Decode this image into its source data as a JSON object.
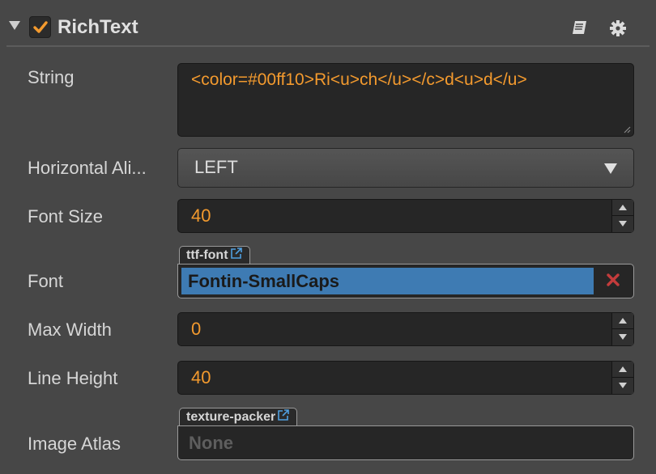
{
  "component": {
    "title": "RichText",
    "enabled": true,
    "icons": {
      "collapse": "triangle-down-icon",
      "enable": "checkbox-icon",
      "docs": "book-icon",
      "settings": "gear-icon"
    }
  },
  "colors": {
    "panel_bg": "#474747",
    "field_bg": "#262626",
    "value_accent": "#f39a2e",
    "selection_blue": "#3e7bb3",
    "clear_red": "#c43c3c"
  },
  "properties": {
    "string": {
      "label": "String",
      "value": "<color=#00ff10>Ri<u>ch</u></c>d<u>d</u>"
    },
    "horizontal_align": {
      "label": "Horizontal Ali...",
      "value": "LEFT"
    },
    "font_size": {
      "label": "Font Size",
      "value": "40"
    },
    "font": {
      "label": "Font",
      "asset_type": "ttf-font",
      "value": "Fontin-SmallCaps"
    },
    "max_width": {
      "label": "Max Width",
      "value": "0"
    },
    "line_height": {
      "label": "Line Height",
      "value": "40"
    },
    "image_atlas": {
      "label": "Image Atlas",
      "asset_type": "texture-packer",
      "value": "None"
    }
  }
}
